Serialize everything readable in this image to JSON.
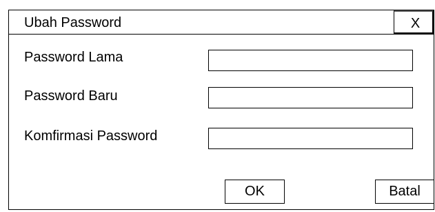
{
  "dialog": {
    "title": "Ubah Password",
    "close_label": "X"
  },
  "form": {
    "fields": [
      {
        "label": "Password Lama",
        "value": ""
      },
      {
        "label": "Password Baru",
        "value": ""
      },
      {
        "label": "Komfirmasi Password",
        "value": ""
      }
    ]
  },
  "buttons": {
    "ok_label": "OK",
    "cancel_label": "Batal"
  }
}
